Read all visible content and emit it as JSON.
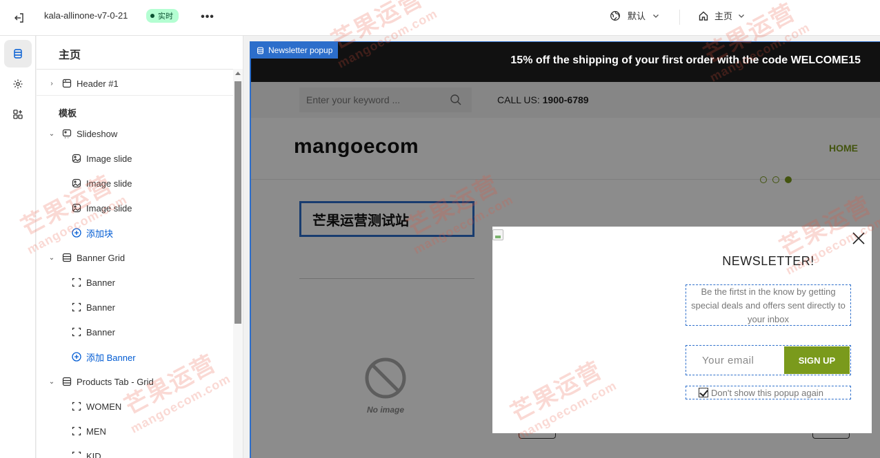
{
  "topbar": {
    "theme_name": "kala-allinone-v7-0-21",
    "status_badge": "实时",
    "more_label": "•••",
    "default_label": "默认",
    "page_label": "主页"
  },
  "panel": {
    "title": "主页",
    "header_item": "Header #1",
    "template_label": "模板",
    "sections": [
      {
        "label": "Slideshow",
        "children": [
          "Image slide",
          "Image slide",
          "Image slide"
        ],
        "add_label": "添加块"
      },
      {
        "label": "Banner Grid",
        "children": [
          "Banner",
          "Banner",
          "Banner"
        ],
        "add_label": "添加 Banner"
      },
      {
        "label": "Products Tab - Grid",
        "children": [
          "WOMEN",
          "MEN",
          "KID"
        ]
      }
    ]
  },
  "preview": {
    "section_tag": "Newsletter popup",
    "announcement": "15% off the shipping of your first order with the code WELCOME15",
    "search_placeholder": "Enter your keyword ...",
    "call_us_label": "CALL US:",
    "call_us_number": "1900-6789",
    "logo_text": "mangoecom",
    "nav_home": "HOME",
    "store_title": "芒果运营测试站",
    "no_image_label": "No image"
  },
  "popup": {
    "title": "NEWSLETTER!",
    "description": "Be the firtst in the know by getting special deals and offers sent directly to your inbox",
    "email_placeholder": "Your email",
    "signup_label": "SIGN UP",
    "dont_show_label": "Don't show this popup again",
    "dont_show_checked": true
  },
  "watermark": {
    "text": "芒果运营",
    "subtext": "mangoecom.com"
  },
  "colors": {
    "accent": "#7a9a1c",
    "selection": "#2c6ecb",
    "link": "#005bd3",
    "badge_bg": "#b4fed2"
  }
}
